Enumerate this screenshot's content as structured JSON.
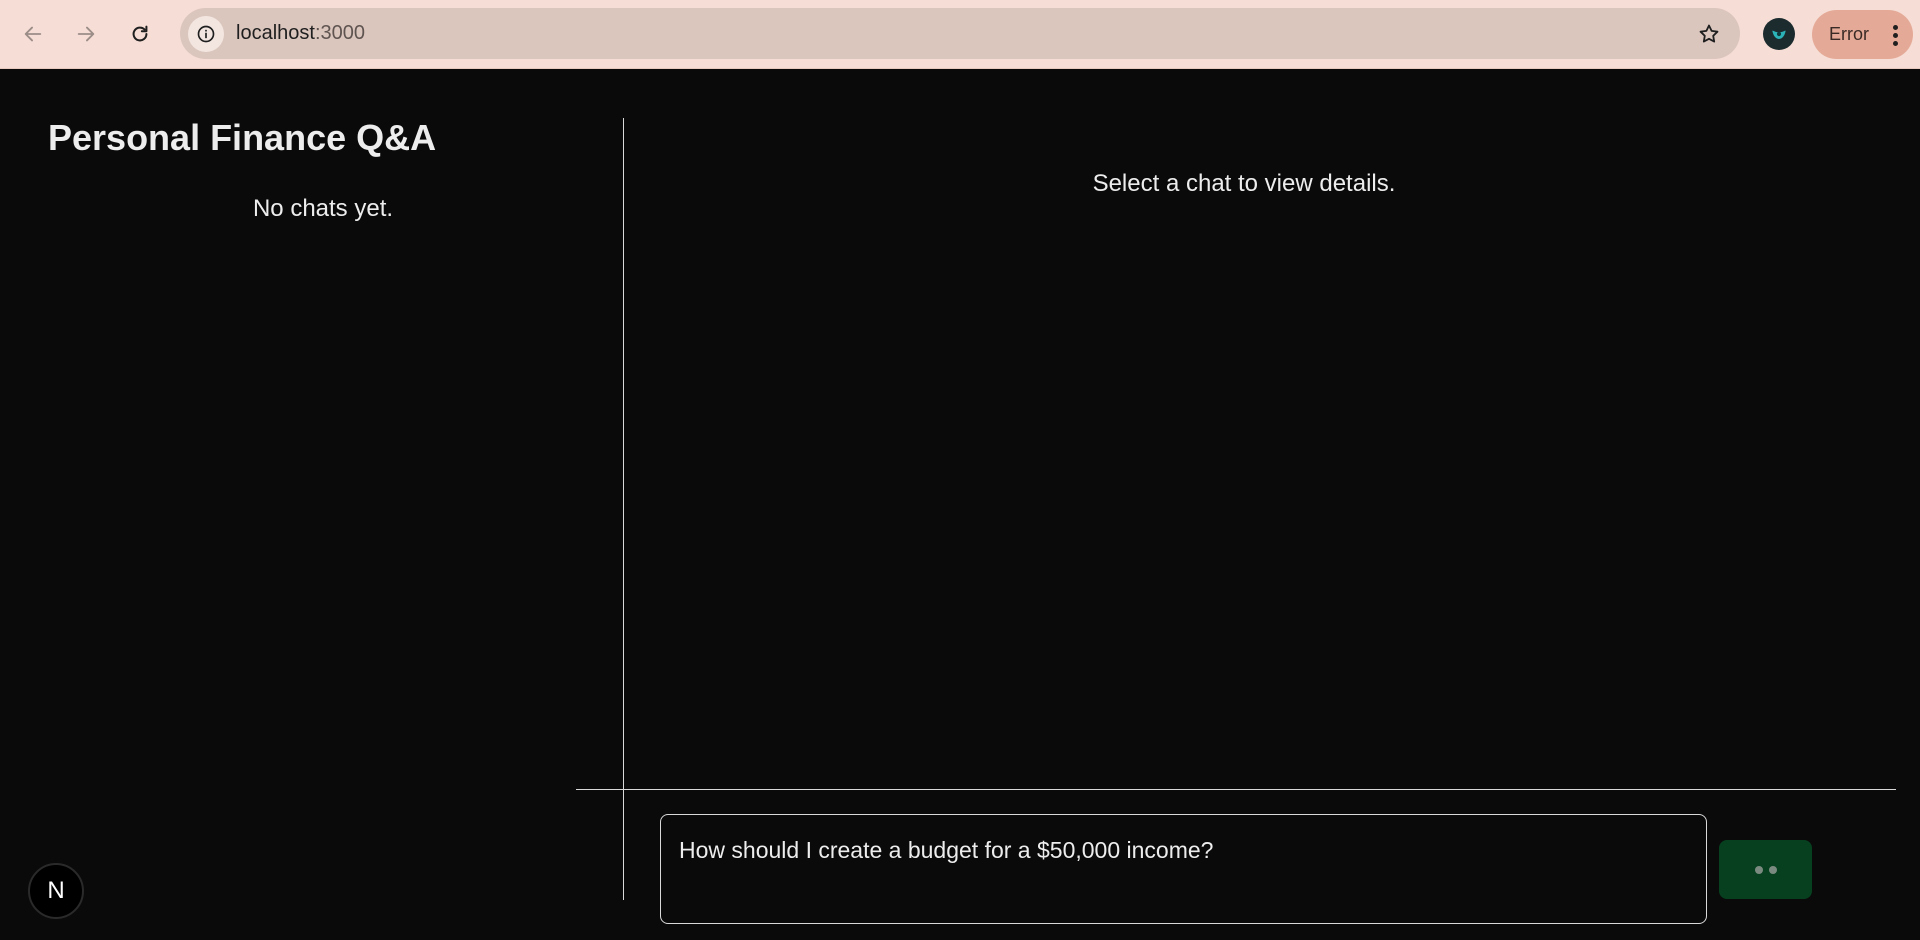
{
  "browser": {
    "url_host": "localhost",
    "url_port": ":3000",
    "error_label": "Error",
    "icons": {
      "back": "arrow-left-icon",
      "forward": "arrow-right-icon",
      "reload": "reload-icon",
      "site_info": "info-icon",
      "bookmark": "star-icon",
      "menu": "kebab-menu-icon"
    }
  },
  "sidebar": {
    "title": "Personal Finance Q&A",
    "empty_text": "No chats yet."
  },
  "main": {
    "placeholder": "Select a chat to view details."
  },
  "composer": {
    "input_value": "How should I create a budget for a $50,000 income?",
    "send_state": "loading"
  },
  "dev_badge": {
    "letter": "N"
  },
  "colors": {
    "background": "#0a0a0a",
    "text": "#ededed",
    "send_button": "#06401f",
    "browser_bar": "#f6ddd5",
    "error_chip": "#e5aa97"
  }
}
